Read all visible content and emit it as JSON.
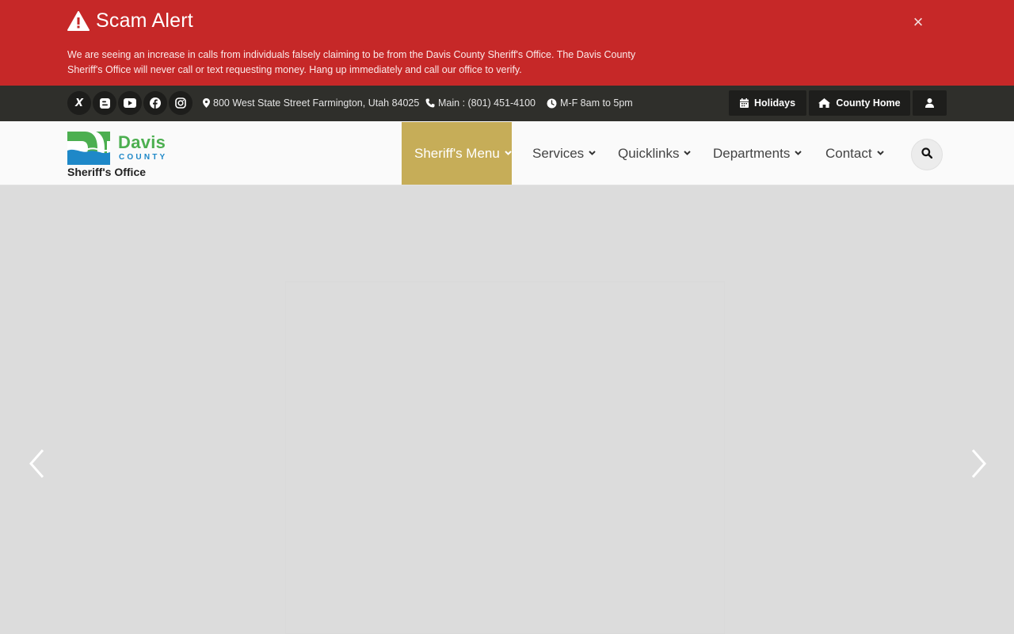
{
  "alert": {
    "title": "Scam Alert",
    "close_label": "×",
    "message": "We are seeing an increase in calls from individuals falsely claiming to be from the Davis County Sheriff's Office. The Davis County Sheriff's Office will never call or text requesting money. Hang up immediately and call our office to verify.",
    "icon": "warning-triangle-icon",
    "color": "#c62828"
  },
  "topbar": {
    "socials": [
      {
        "name": "x-icon",
        "glyph": "X"
      },
      {
        "name": "blogger-icon"
      },
      {
        "name": "youtube-icon"
      },
      {
        "name": "facebook-icon"
      },
      {
        "name": "instagram-icon"
      }
    ],
    "address": "800 West State Street Farmington, Utah 84025",
    "phone": "Main : (801) 451-4100",
    "hours": "M-F 8am to 5pm",
    "buttons": {
      "holidays": "Holidays",
      "county_home": "County Home"
    },
    "color": "#2f2f2b"
  },
  "logo": {
    "word": "Davis",
    "county": "COUNTY",
    "subtitle": "Sheriff's Office"
  },
  "nav": {
    "items": [
      {
        "label": "Sheriff's Menu",
        "active": true
      },
      {
        "label": "Services"
      },
      {
        "label": "Quicklinks"
      },
      {
        "label": "Departments"
      },
      {
        "label": "Contact"
      }
    ],
    "accent": "#c6ad58"
  }
}
